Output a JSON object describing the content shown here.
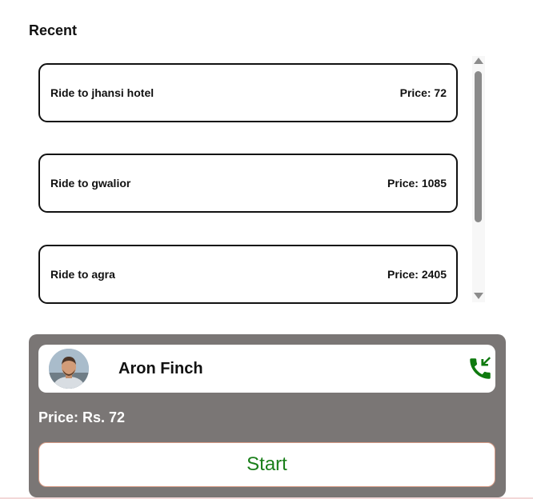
{
  "recent": {
    "title": "Recent",
    "rides": [
      {
        "destination": "Ride to jhansi hotel",
        "price": "Price: 72"
      },
      {
        "destination": "Ride to gwalior",
        "price": "Price: 1085"
      },
      {
        "destination": "Ride to agra",
        "price": "Price: 2405"
      }
    ]
  },
  "driver": {
    "name": "Aron Finch",
    "avatar_icon": "driver-photo",
    "call_icon": "phone-call-icon",
    "call_color": "#0f7a0f"
  },
  "booking": {
    "price": "Price: Rs. 72",
    "start_label": "Start"
  },
  "colors": {
    "panel": "#7a7675",
    "start_text": "#1a7f1a",
    "card_border": "#111111"
  }
}
